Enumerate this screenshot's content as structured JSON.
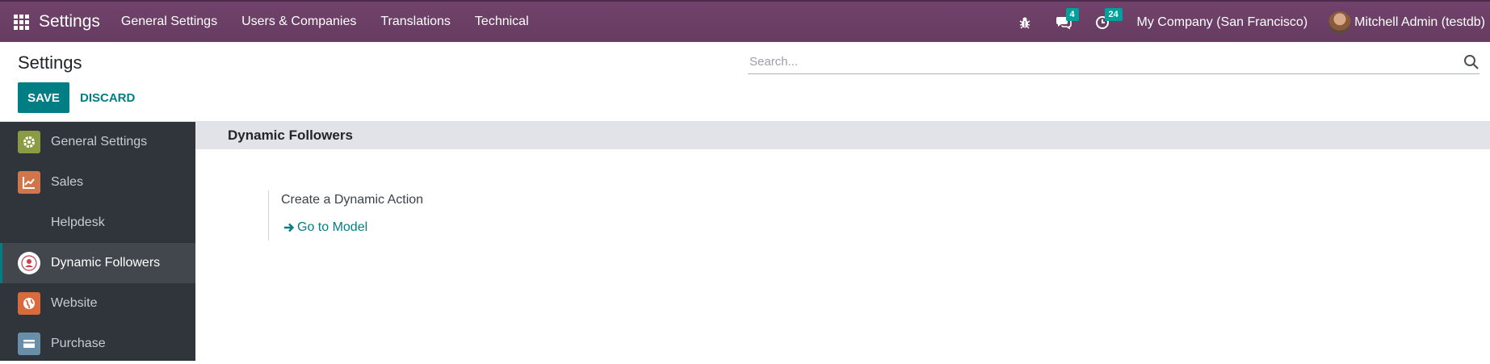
{
  "navbar": {
    "brand": "Settings",
    "menu": [
      "General Settings",
      "Users & Companies",
      "Translations",
      "Technical"
    ],
    "messages_count": "4",
    "activities_count": "24",
    "company": "My Company (San Francisco)",
    "user": "Mitchell Admin (testdb)"
  },
  "control": {
    "title": "Settings",
    "save_label": "SAVE",
    "discard_label": "DISCARD",
    "search_placeholder": "Search..."
  },
  "sidebar": {
    "items": [
      {
        "label": "General Settings",
        "icon": "gear-icon",
        "color": "#8a9b43"
      },
      {
        "label": "Sales",
        "icon": "chart-icon",
        "color": "#d3754a"
      },
      {
        "label": "Helpdesk",
        "icon": "",
        "color": ""
      },
      {
        "label": "Dynamic Followers",
        "icon": "followers-icon",
        "color": "#ffffff"
      },
      {
        "label": "Website",
        "icon": "globe-icon",
        "color": "#d86a3e"
      },
      {
        "label": "Purchase",
        "icon": "card-icon",
        "color": "#6a8ea8"
      }
    ],
    "active": "Dynamic Followers"
  },
  "content": {
    "section_title": "Dynamic Followers",
    "setting_label": "Create a Dynamic Action",
    "link_label": "Go to Model"
  },
  "colors": {
    "navbar": "#6b3e66",
    "primary": "#017e84",
    "sidebar": "#2f353b",
    "badge": "#00a09d"
  }
}
